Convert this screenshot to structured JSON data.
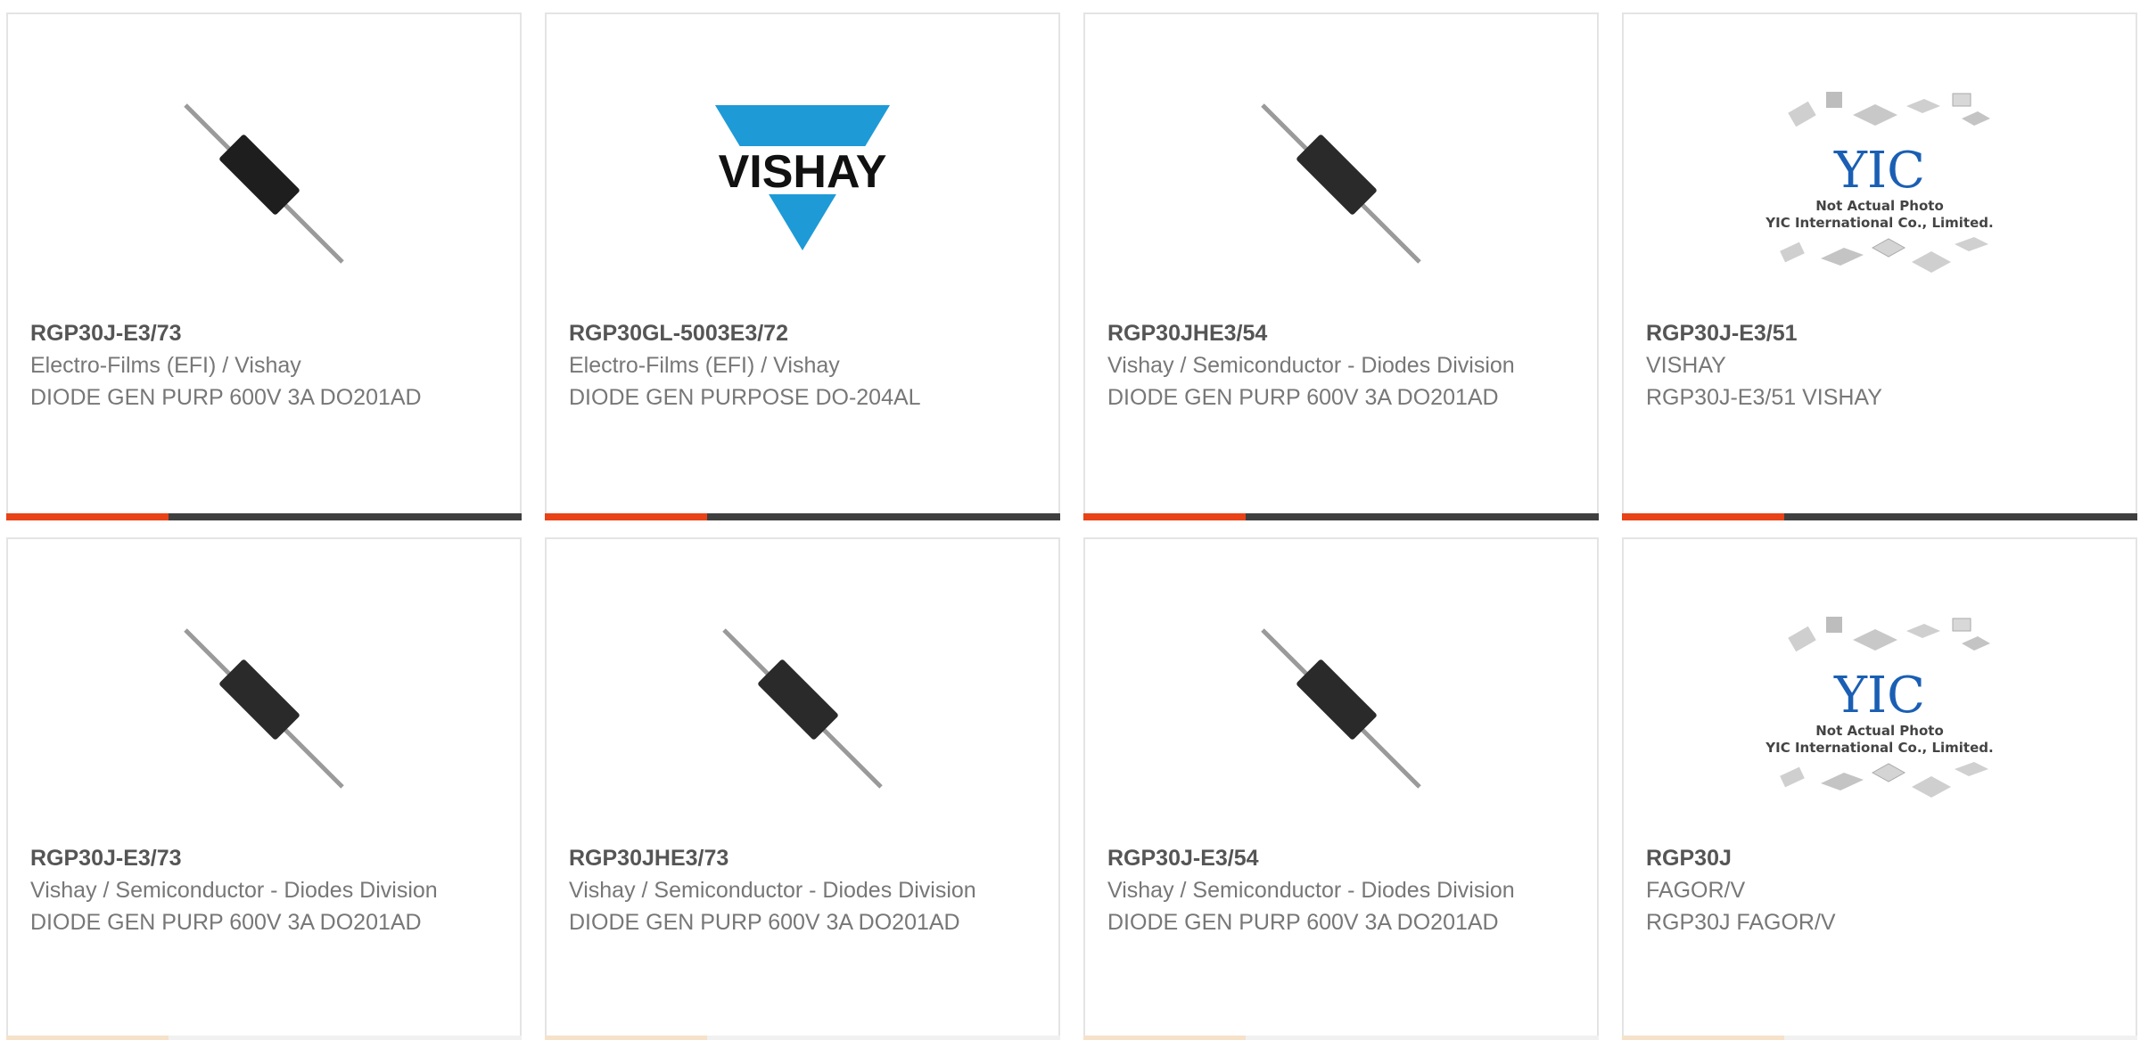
{
  "colors": {
    "accent": "#e84217",
    "bar": "#3f3f3f",
    "border": "#e4e4e4",
    "text": "#777777",
    "vishay_blue": "#1e9ad7"
  },
  "products": [
    {
      "image": "diode-image",
      "part_number": "RGP30J-E3/73",
      "manufacturer": "Electro-Films (EFI) / Vishay",
      "description": "DIODE GEN PURP 600V 3A DO201AD"
    },
    {
      "image": "vishay-logo",
      "logo_text": "VISHAY",
      "part_number": "RGP30GL-5003E3/72",
      "manufacturer": "Electro-Films (EFI) / Vishay",
      "description": "DIODE GEN PURPOSE DO-204AL"
    },
    {
      "image": "diode-image",
      "part_number": "RGP30JHE3/54",
      "manufacturer": "Vishay / Semiconductor - Diodes Division",
      "description": "DIODE GEN PURP 600V 3A DO201AD"
    },
    {
      "image": "yic-placeholder",
      "placeholder_line1": "Not Actual Photo",
      "placeholder_line2": "YIC International Co., Limited.",
      "part_number": "RGP30J-E3/51",
      "manufacturer": "VISHAY",
      "description": "RGP30J-E3/51 VISHAY"
    },
    {
      "image": "diode-image",
      "part_number": "RGP30J-E3/73",
      "manufacturer": "Vishay / Semiconductor - Diodes Division",
      "description": "DIODE GEN PURP 600V 3A DO201AD"
    },
    {
      "image": "diode-image",
      "part_number": "RGP30JHE3/73",
      "manufacturer": "Vishay / Semiconductor - Diodes Division",
      "description": "DIODE GEN PURP 600V 3A DO201AD"
    },
    {
      "image": "diode-image",
      "part_number": "RGP30J-E3/54",
      "manufacturer": "Vishay / Semiconductor - Diodes Division",
      "description": "DIODE GEN PURP 600V 3A DO201AD"
    },
    {
      "image": "yic-placeholder",
      "placeholder_line1": "Not Actual Photo",
      "placeholder_line2": "YIC International Co., Limited.",
      "part_number": "RGP30J",
      "manufacturer": "FAGOR/V",
      "description": "RGP30J FAGOR/V"
    }
  ]
}
